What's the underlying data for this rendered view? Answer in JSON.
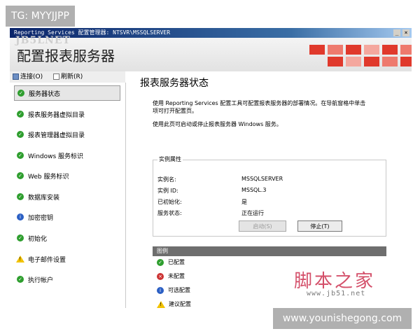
{
  "window": {
    "title": "Reporting Services 配置管理器: NTSVR\\MSSQLSERVER",
    "minimize": "_",
    "close": "×"
  },
  "app": {
    "header_ghost": "JB5LNET",
    "title": "配置报表服务器"
  },
  "toolbar": {
    "connect": "连接(O)",
    "refresh": "刷新(R)"
  },
  "sidebar": {
    "items": [
      {
        "label": "服务器状态",
        "icon": "check-icon"
      },
      {
        "label": "报表服务器虚拟目录",
        "icon": "check-icon"
      },
      {
        "label": "报表管理器虚拟目录",
        "icon": "check-icon"
      },
      {
        "label": "Windows 服务标识",
        "icon": "check-icon"
      },
      {
        "label": "Web 服务标识",
        "icon": "check-icon"
      },
      {
        "label": "数据库安装",
        "icon": "check-icon"
      },
      {
        "label": "加密密钥",
        "icon": "info-icon"
      },
      {
        "label": "初始化",
        "icon": "check-icon"
      },
      {
        "label": "电子邮件设置",
        "icon": "warning-icon"
      },
      {
        "label": "执行帐户",
        "icon": "check-icon"
      }
    ],
    "selected": "服务器状态"
  },
  "main": {
    "title": "报表服务器状态",
    "desc_line1": "使用 Reporting Services 配置工具可配置报表服务器的部署情况。在导航窗格中单击",
    "desc_line2": "项可打开配置页。",
    "desc_line3": "使用此页可启动或停止报表服务器 Windows 服务。",
    "instance": {
      "group_title": "实例属性",
      "rows": [
        {
          "label": "实例名:",
          "value": "MSSQLSERVER"
        },
        {
          "label": "实例 ID:",
          "value": "MSSQL.3"
        },
        {
          "label": "已初始化:",
          "value": "是"
        },
        {
          "label": "服务状态:",
          "value": "正在运行"
        }
      ],
      "start_button": "启动(S)",
      "stop_button": "停止(T)"
    },
    "legend": {
      "title": "图例",
      "items": [
        {
          "label": "已配置",
          "icon": "check-icon"
        },
        {
          "label": "未配置",
          "icon": "error-icon"
        },
        {
          "label": "可选配置",
          "icon": "info-icon"
        },
        {
          "label": "建议配置",
          "icon": "warning-icon"
        }
      ]
    }
  },
  "watermarks": {
    "top_left": "TG: MYYJJPP",
    "bottom_right": "www.younishegong.com",
    "jb51_logo": "脚本之家",
    "jb51_url": "www.jb51.net"
  },
  "colors": {
    "accent_red": "#e0392c",
    "check_green": "#2e9e2e",
    "info_blue": "#2b5fc4",
    "warning_yellow": "#f2c200"
  }
}
